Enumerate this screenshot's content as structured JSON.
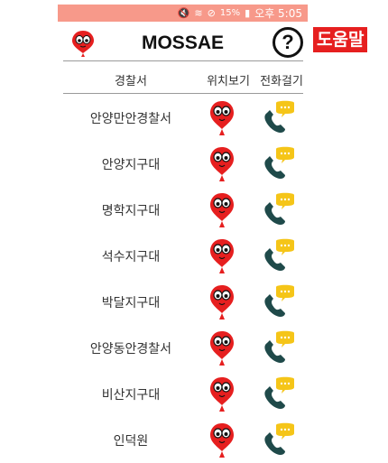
{
  "status_bar": {
    "battery": "15%",
    "time": "오후 5:05"
  },
  "app": {
    "title": "MOSSAE",
    "help_label": "도움말",
    "help_symbol": "?"
  },
  "table": {
    "headers": {
      "station": "경찰서",
      "location": "위치보기",
      "call": "전화걸기"
    },
    "rows": [
      {
        "name": "안양만안경찰서"
      },
      {
        "name": "안양지구대"
      },
      {
        "name": "명학지구대"
      },
      {
        "name": "석수지구대"
      },
      {
        "name": "박달지구대"
      },
      {
        "name": "안양동안경찰서"
      },
      {
        "name": "비산지구대"
      },
      {
        "name": "인덕원"
      }
    ]
  },
  "icons": {
    "logo": "balloon-mascot-icon",
    "location": "balloon-mascot-pin-icon",
    "call": "phone-with-speech-bubble-icon",
    "help": "question-circle-icon"
  },
  "colors": {
    "status_bar": "#f7998a",
    "accent_red": "#e61f1f",
    "phone": "#1f4a4a",
    "bubble": "#f5c518"
  }
}
